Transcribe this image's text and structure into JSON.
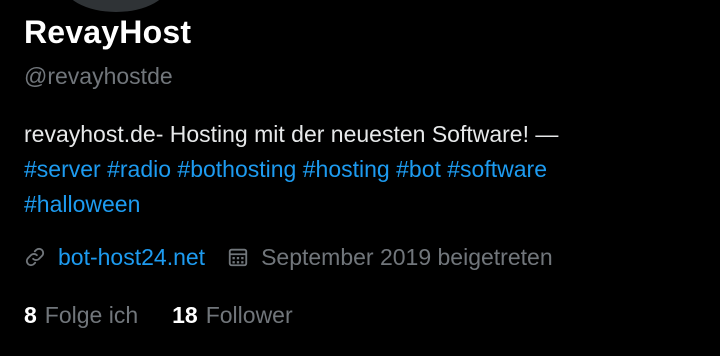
{
  "profile": {
    "display_name": "RevayHost",
    "handle": "@revayhostde",
    "bio_text": "revayhost.de- Hosting mit der neuesten Software! —",
    "bio_hashtags": [
      "#server",
      "#radio",
      "#bothosting",
      "#hosting",
      "#bot",
      "#software",
      "#halloween"
    ],
    "website": "bot-host24.net",
    "joined": "September 2019 beigetreten",
    "following_count": "8",
    "following_label": "Folge ich",
    "followers_count": "18",
    "followers_label": "Follower"
  },
  "icons": {
    "website": "link-icon",
    "joined": "calendar-icon"
  },
  "colors": {
    "background": "#000000",
    "primary_text": "#e7e9ea",
    "secondary_text": "#71767b",
    "accent": "#1d9bf0"
  }
}
